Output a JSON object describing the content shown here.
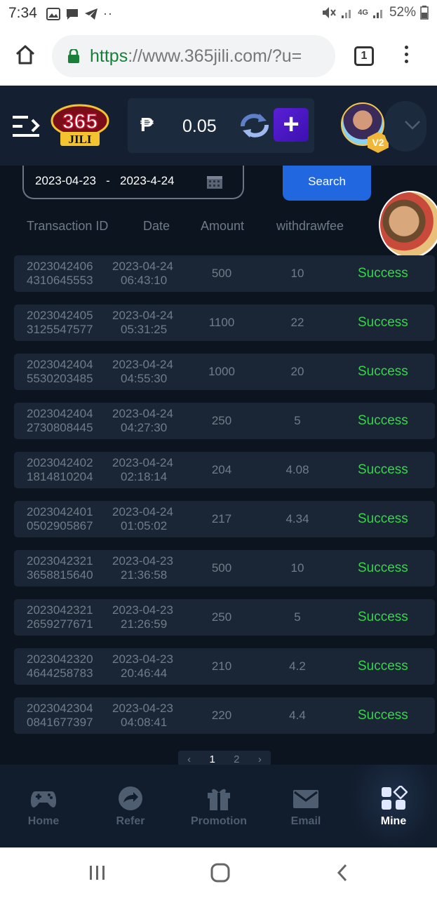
{
  "status_bar": {
    "time": "7:34",
    "network": "4G",
    "battery": "52%"
  },
  "browser": {
    "url_scheme": "https",
    "url_rest": "://www.365jili.com/?u=",
    "tab_count": "1"
  },
  "header": {
    "logo_text_top": "365",
    "logo_text_bottom": "JILI",
    "currency_symbol": "₱",
    "balance": "0.05",
    "vip_level": "V2"
  },
  "filter": {
    "date_from": "2023-04-23",
    "separator": "-",
    "date_to": "2023-4-24",
    "search_label": "Search"
  },
  "table": {
    "headers": [
      "Transaction ID",
      "Date",
      "Amount",
      "withdrawfee"
    ],
    "rows": [
      {
        "id1": "2023042406",
        "id2": "4310645553",
        "date": "2023-04-24",
        "time": "06:43:10",
        "amount": "500",
        "fee": "10",
        "status": "Success"
      },
      {
        "id1": "2023042405",
        "id2": "3125547577",
        "date": "2023-04-24",
        "time": "05:31:25",
        "amount": "1100",
        "fee": "22",
        "status": "Success"
      },
      {
        "id1": "2023042404",
        "id2": "5530203485",
        "date": "2023-04-24",
        "time": "04:55:30",
        "amount": "1000",
        "fee": "20",
        "status": "Success"
      },
      {
        "id1": "2023042404",
        "id2": "2730808445",
        "date": "2023-04-24",
        "time": "04:27:30",
        "amount": "250",
        "fee": "5",
        "status": "Success"
      },
      {
        "id1": "2023042402",
        "id2": "1814810204",
        "date": "2023-04-24",
        "time": "02:18:14",
        "amount": "204",
        "fee": "4.08",
        "status": "Success"
      },
      {
        "id1": "2023042401",
        "id2": "0502905867",
        "date": "2023-04-24",
        "time": "01:05:02",
        "amount": "217",
        "fee": "4.34",
        "status": "Success"
      },
      {
        "id1": "2023042321",
        "id2": "3658815640",
        "date": "2023-04-23",
        "time": "21:36:58",
        "amount": "500",
        "fee": "10",
        "status": "Success"
      },
      {
        "id1": "2023042321",
        "id2": "2659277671",
        "date": "2023-04-23",
        "time": "21:26:59",
        "amount": "250",
        "fee": "5",
        "status": "Success"
      },
      {
        "id1": "2023042320",
        "id2": "4644258783",
        "date": "2023-04-23",
        "time": "20:46:44",
        "amount": "210",
        "fee": "4.2",
        "status": "Success"
      },
      {
        "id1": "2023042304",
        "id2": "0841677397",
        "date": "2023-04-23",
        "time": "04:08:41",
        "amount": "220",
        "fee": "4.4",
        "status": "Success"
      }
    ]
  },
  "pagination": {
    "prev": "‹",
    "current": "1",
    "next_page": "2",
    "next": "›"
  },
  "bottom_nav": [
    {
      "label": "Home",
      "icon": "gamepad-icon"
    },
    {
      "label": "Refer",
      "icon": "share-icon"
    },
    {
      "label": "Promotion",
      "icon": "gift-icon"
    },
    {
      "label": "Email",
      "icon": "email-icon"
    },
    {
      "label": "Mine",
      "icon": "mine-icon",
      "active": true
    }
  ],
  "colors": {
    "app_bg": "#0c1420",
    "header_bg": "#142032",
    "row_bg": "#1a2636",
    "success": "#37d44a",
    "search_btn": "#2167e0",
    "plus_btn": "#4a18c8"
  }
}
